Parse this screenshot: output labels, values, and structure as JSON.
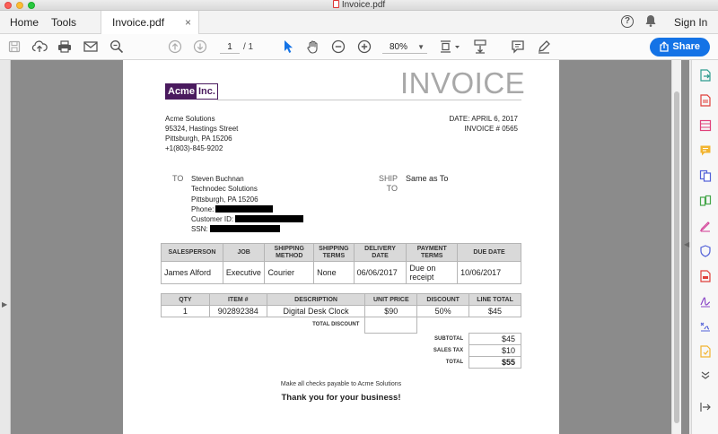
{
  "window": {
    "title": "Invoice.pdf"
  },
  "tabs": {
    "home": "Home",
    "tools": "Tools",
    "document": "Invoice.pdf",
    "close": "×"
  },
  "header": {
    "sign_in": "Sign In",
    "help": "?"
  },
  "toolbar": {
    "page_current": "1",
    "page_total": "/ 1",
    "zoom": "80%",
    "share": "Share"
  },
  "invoice": {
    "logo_left": "Acme",
    "logo_right": "Inc.",
    "title": "INVOICE",
    "company": [
      "Acme Solutions",
      "95324, Hastings Street",
      "Pittsburgh, PA 15206",
      "+1(803)-845-9202"
    ],
    "date": "DATE: APRIL 6, 2017",
    "number": "INVOICE # 0565",
    "to_label": "TO",
    "to": {
      "name": "Steven Buchnan",
      "company": "Technodec Solutions",
      "city": "Pittsburgh, PA 15206",
      "phone_label": "Phone:",
      "customer_label": "Customer ID:",
      "ssn_label": "SSN:"
    },
    "ship_label_1": "SHIP",
    "ship_label_2": "TO",
    "ship_value": "Same as To",
    "sales_table": {
      "headers": [
        "SALESPERSON",
        "JOB",
        "SHIPPING METHOD",
        "SHIPPING TERMS",
        "DELIVERY DATE",
        "PAYMENT TERMS",
        "DUE DATE"
      ],
      "row": [
        "James Alford",
        "Executive",
        "Courier",
        "None",
        "06/06/2017",
        "Due on receipt",
        "10/06/2017"
      ]
    },
    "items_table": {
      "headers": [
        "QTY",
        "ITEM #",
        "DESCRIPTION",
        "UNIT PRICE",
        "DISCOUNT",
        "LINE TOTAL"
      ],
      "row": [
        "1",
        "902892384",
        "Digital Desk Clock",
        "$90",
        "50%",
        "$45"
      ],
      "total_discount_label": "TOTAL DISCOUNT",
      "subtotal_label": "SUBTOTAL",
      "subtotal": "$45",
      "sales_tax_label": "SALES TAX",
      "sales_tax": "$10",
      "total_label": "TOTAL",
      "total": "$55"
    },
    "payable": "Make all checks payable to Acme Solutions",
    "thanks": "Thank you for your business!"
  },
  "colors": {
    "accent": "#1473e6",
    "logo": "#4a1a5e",
    "doc_bg": "#8b8b8b"
  }
}
